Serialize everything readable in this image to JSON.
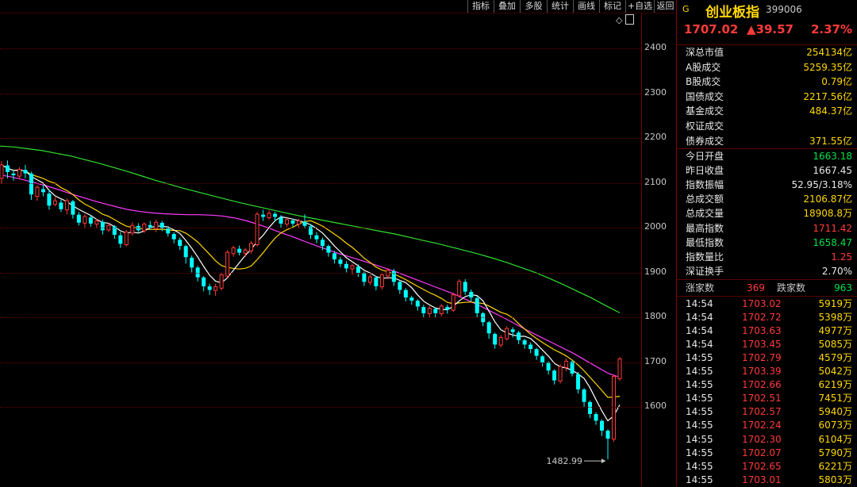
{
  "toolbar": {
    "items": [
      "指标",
      "叠加",
      "多股",
      "统计",
      "画线",
      "标记",
      "+自选",
      "返回"
    ]
  },
  "chart_ctrl": {
    "diamond": "◇"
  },
  "chart_data": {
    "type": "candlestick",
    "y_ticks": [
      2400,
      2300,
      2200,
      2100,
      2000,
      1900,
      1800,
      1700,
      1600
    ],
    "ylim": [
      1423,
      2478
    ],
    "low_annotation": "1482.99",
    "colors": {
      "up": "#ff3b3b",
      "down": "#00ffff",
      "ma5": "#ffffff",
      "ma10": "#ffd400",
      "ma20": "#ff3cff",
      "ma60": "#2ee02e"
    },
    "candles": [
      [
        2110,
        2140,
        2098,
        2148
      ],
      [
        2138,
        2125,
        2110,
        2150
      ],
      [
        2120,
        2118,
        2105,
        2130
      ],
      [
        2115,
        2130,
        2108,
        2135
      ],
      [
        2128,
        2122,
        2110,
        2140
      ],
      [
        2120,
        2075,
        2062,
        2125
      ],
      [
        2070,
        2090,
        2060,
        2095
      ],
      [
        2085,
        2080,
        2070,
        2095
      ],
      [
        2075,
        2050,
        2040,
        2085
      ],
      [
        2052,
        2060,
        2048,
        2068
      ],
      [
        2055,
        2042,
        2035,
        2062
      ],
      [
        2040,
        2060,
        2030,
        2065
      ],
      [
        2058,
        2030,
        2020,
        2062
      ],
      [
        2028,
        2012,
        2005,
        2035
      ],
      [
        2010,
        2025,
        2000,
        2030
      ],
      [
        2022,
        2010,
        2002,
        2028
      ],
      [
        2008,
        2015,
        2000,
        2020
      ],
      [
        2012,
        1995,
        1985,
        2018
      ],
      [
        1995,
        2005,
        1990,
        2010
      ],
      [
        2002,
        1985,
        1975,
        2006
      ],
      [
        1982,
        1965,
        1955,
        1990
      ],
      [
        1962,
        1990,
        1958,
        1995
      ],
      [
        1988,
        2005,
        1982,
        2012
      ],
      [
        2003,
        1995,
        1990,
        2010
      ],
      [
        1993,
        2008,
        1988,
        2012
      ],
      [
        2005,
        2000,
        1995,
        2015
      ],
      [
        1998,
        2012,
        1990,
        2018
      ],
      [
        2010,
        2000,
        1992,
        2015
      ],
      [
        1998,
        1988,
        1980,
        2003
      ],
      [
        1985,
        1975,
        1965,
        1990
      ],
      [
        1972,
        1960,
        1950,
        1978
      ],
      [
        1958,
        1935,
        1920,
        1962
      ],
      [
        1932,
        1912,
        1900,
        1938
      ],
      [
        1910,
        1890,
        1880,
        1915
      ],
      [
        1888,
        1870,
        1858,
        1892
      ],
      [
        1868,
        1862,
        1850,
        1875
      ],
      [
        1860,
        1868,
        1848,
        1875
      ],
      [
        1865,
        1895,
        1860,
        1900
      ],
      [
        1892,
        1945,
        1888,
        1950
      ],
      [
        1942,
        1955,
        1935,
        1960
      ],
      [
        1952,
        1945,
        1938,
        1960
      ],
      [
        1943,
        1950,
        1935,
        1955
      ],
      [
        1948,
        1965,
        1942,
        1970
      ],
      [
        1962,
        2030,
        1958,
        2035
      ],
      [
        2028,
        2025,
        2015,
        2040
      ],
      [
        2022,
        2032,
        2018,
        2038
      ],
      [
        2030,
        2025,
        2015,
        2035
      ],
      [
        2022,
        2010,
        2000,
        2028
      ],
      [
        2008,
        2018,
        2002,
        2022
      ],
      [
        2015,
        2010,
        2002,
        2020
      ],
      [
        2008,
        2015,
        2000,
        2020
      ],
      [
        2012,
        2005,
        1998,
        2030
      ],
      [
        2002,
        1985,
        1975,
        2008
      ],
      [
        1982,
        1975,
        1965,
        1990
      ],
      [
        1972,
        1960,
        1950,
        1978
      ],
      [
        1958,
        1945,
        1935,
        1962
      ],
      [
        1942,
        1930,
        1920,
        1948
      ],
      [
        1928,
        1920,
        1912,
        1935
      ],
      [
        1918,
        1910,
        1900,
        1925
      ],
      [
        1908,
        1915,
        1895,
        1920
      ],
      [
        1912,
        1900,
        1890,
        1918
      ],
      [
        1898,
        1880,
        1870,
        1902
      ],
      [
        1878,
        1890,
        1872,
        1895
      ],
      [
        1888,
        1870,
        1860,
        1892
      ],
      [
        1868,
        1895,
        1862,
        1900
      ],
      [
        1892,
        1905,
        1885,
        1910
      ],
      [
        1902,
        1880,
        1870,
        1908
      ],
      [
        1878,
        1862,
        1852,
        1882
      ],
      [
        1860,
        1845,
        1835,
        1865
      ],
      [
        1843,
        1838,
        1828,
        1848
      ],
      [
        1836,
        1825,
        1815,
        1840
      ],
      [
        1822,
        1810,
        1800,
        1828
      ],
      [
        1808,
        1820,
        1800,
        1825
      ],
      [
        1818,
        1810,
        1800,
        1822
      ],
      [
        1808,
        1825,
        1802,
        1830
      ],
      [
        1822,
        1818,
        1808,
        1828
      ],
      [
        1816,
        1850,
        1812,
        1855
      ],
      [
        1848,
        1880,
        1844,
        1885
      ],
      [
        1878,
        1858,
        1850,
        1885
      ],
      [
        1856,
        1845,
        1835,
        1862
      ],
      [
        1842,
        1810,
        1800,
        1848
      ],
      [
        1808,
        1790,
        1780,
        1812
      ],
      [
        1788,
        1765,
        1752,
        1792
      ],
      [
        1762,
        1740,
        1730,
        1766
      ],
      [
        1738,
        1755,
        1732,
        1760
      ],
      [
        1752,
        1775,
        1748,
        1780
      ],
      [
        1772,
        1768,
        1755,
        1778
      ],
      [
        1765,
        1750,
        1740,
        1770
      ],
      [
        1748,
        1740,
        1730,
        1752
      ],
      [
        1738,
        1730,
        1720,
        1744
      ],
      [
        1728,
        1715,
        1705,
        1732
      ],
      [
        1712,
        1700,
        1690,
        1716
      ],
      [
        1698,
        1682,
        1672,
        1702
      ],
      [
        1680,
        1660,
        1650,
        1684
      ],
      [
        1658,
        1690,
        1652,
        1695
      ],
      [
        1688,
        1702,
        1680,
        1708
      ],
      [
        1700,
        1675,
        1668,
        1705
      ],
      [
        1672,
        1640,
        1630,
        1678
      ],
      [
        1638,
        1612,
        1600,
        1642
      ],
      [
        1610,
        1585,
        1575,
        1614
      ],
      [
        1583,
        1570,
        1560,
        1588
      ],
      [
        1568,
        1548,
        1535,
        1572
      ],
      [
        1546,
        1530,
        1483,
        1550
      ],
      [
        1528,
        1668,
        1522,
        1672
      ],
      [
        1663,
        1707,
        1658,
        1711
      ]
    ],
    "ma60": [
      2182,
      2180,
      2176,
      2172,
      2166,
      2160,
      2152,
      2144,
      2135,
      2126,
      2116,
      2106,
      2097,
      2088,
      2080,
      2072,
      2064,
      2056,
      2049,
      2042,
      2035,
      2028,
      2022,
      2016,
      2010,
      2004,
      1998,
      1992,
      1986,
      1979,
      1972,
      1965,
      1957,
      1949,
      1941,
      1932,
      1922,
      1911,
      1900,
      1887,
      1873,
      1858,
      1843,
      1826,
      1810
    ],
    "ma20": [
      2118,
      2113,
      2107,
      2100,
      2093,
      2085,
      2076,
      2068,
      2060,
      2053,
      2046,
      2040,
      2036,
      2033,
      2031,
      2030,
      2029,
      2029,
      2028,
      2026,
      2022,
      2016,
      2008,
      1999,
      1989,
      1980,
      1970,
      1960,
      1951,
      1942,
      1934,
      1926,
      1918,
      1909,
      1900,
      1890,
      1880,
      1870,
      1860,
      1850,
      1838,
      1826,
      1813,
      1800,
      1786,
      1772,
      1759,
      1746,
      1733,
      1720,
      1705,
      1690,
      1675,
      1666
    ]
  },
  "panel": {
    "code_prefix": "G",
    "name": "创业板指",
    "code": "399006",
    "price": "1707.02",
    "change": "▲39.57",
    "change_pct": "2.37%",
    "market_rows": [
      {
        "label": "深总市值",
        "value": "254134亿"
      },
      {
        "label": "A股成交",
        "value": "5259.35亿"
      },
      {
        "label": "B股成交",
        "value": "0.79亿"
      },
      {
        "label": "国债成交",
        "value": "2217.56亿"
      },
      {
        "label": "基金成交",
        "value": "484.37亿"
      },
      {
        "label": "权证成交",
        "value": ""
      },
      {
        "label": "债券成交",
        "value": "371.55亿"
      }
    ],
    "index_rows": [
      {
        "label": "今日开盘",
        "value": "1663.18",
        "color": "green"
      },
      {
        "label": "昨日收盘",
        "value": "1667.45",
        "color": "white"
      },
      {
        "label": "指数振幅",
        "value": "52.95/3.18%",
        "color": "white"
      },
      {
        "label": "总成交额",
        "value": "2106.87亿",
        "color": "yellow"
      },
      {
        "label": "总成交量",
        "value": "18908.8万",
        "color": "yellow"
      },
      {
        "label": "最高指数",
        "value": "1711.42",
        "color": "red"
      },
      {
        "label": "最低指数",
        "value": "1658.47",
        "color": "green"
      },
      {
        "label": "指数量比",
        "value": "1.25",
        "color": "red"
      },
      {
        "label": "深证换手",
        "value": "2.70%",
        "color": "white"
      }
    ],
    "breadth": {
      "up_label": "涨家数",
      "up": "369",
      "down_label": "跌家数",
      "down": "963"
    },
    "ticks": [
      {
        "time": "14:54",
        "price": "1703.02",
        "vol": "5919万"
      },
      {
        "time": "14:54",
        "price": "1702.72",
        "vol": "5398万"
      },
      {
        "time": "14:54",
        "price": "1703.63",
        "vol": "4977万"
      },
      {
        "time": "14:54",
        "price": "1703.45",
        "vol": "5085万"
      },
      {
        "time": "14:55",
        "price": "1702.79",
        "vol": "4579万"
      },
      {
        "time": "14:55",
        "price": "1703.39",
        "vol": "5042万"
      },
      {
        "time": "14:55",
        "price": "1702.66",
        "vol": "6219万"
      },
      {
        "time": "14:55",
        "price": "1702.51",
        "vol": "7451万"
      },
      {
        "time": "14:55",
        "price": "1702.57",
        "vol": "5940万"
      },
      {
        "time": "14:55",
        "price": "1702.24",
        "vol": "6073万"
      },
      {
        "time": "14:55",
        "price": "1702.30",
        "vol": "6104万"
      },
      {
        "time": "14:55",
        "price": "1702.07",
        "vol": "5790万"
      },
      {
        "time": "14:55",
        "price": "1702.65",
        "vol": "6221万"
      },
      {
        "time": "14:55",
        "price": "1703.01",
        "vol": "5803万"
      }
    ]
  }
}
